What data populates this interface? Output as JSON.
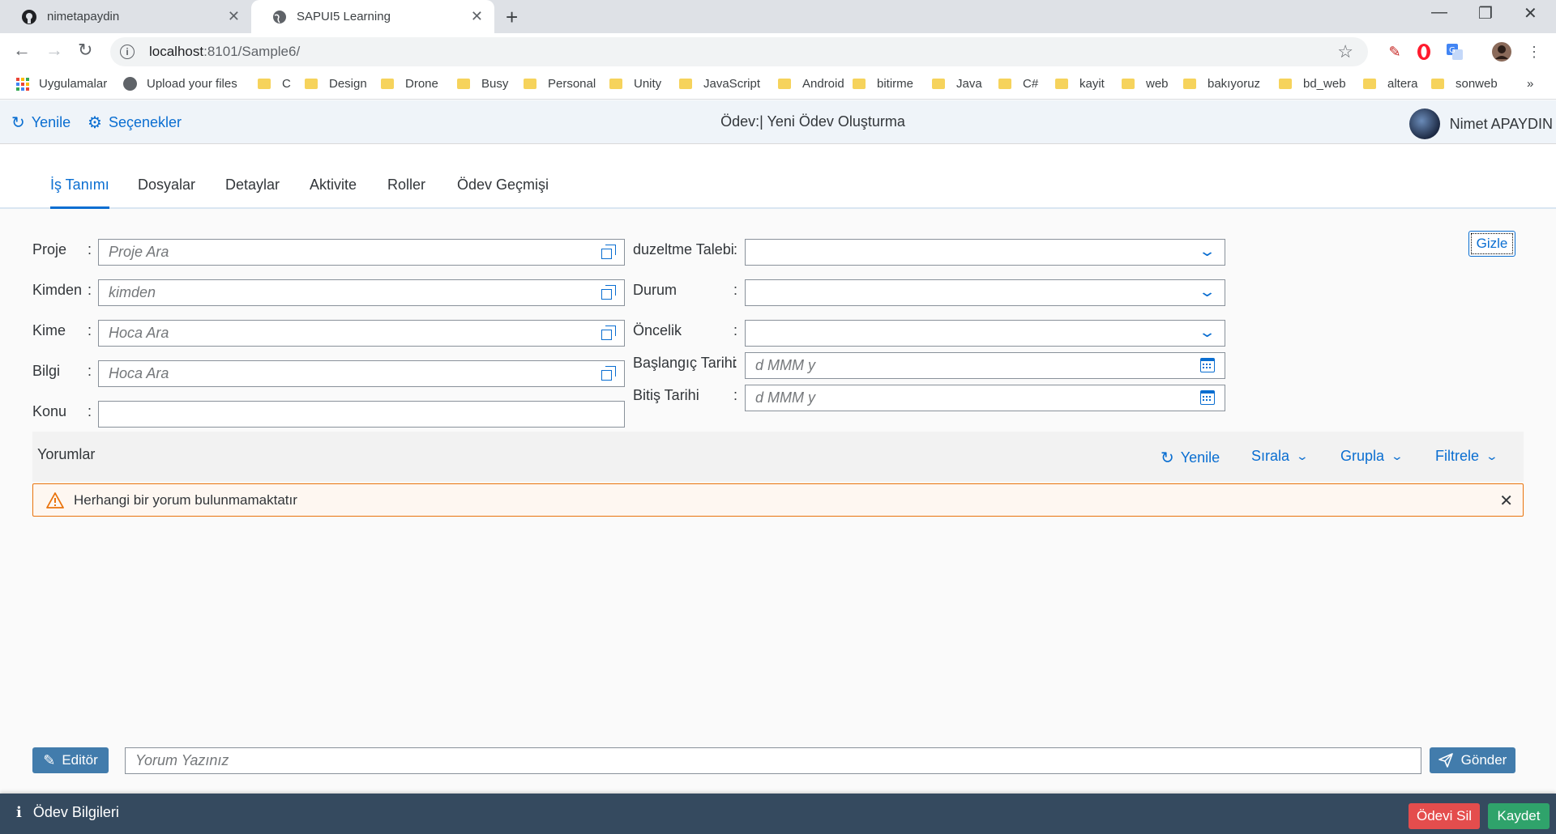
{
  "browser": {
    "tabs": [
      {
        "title": "nimetapaydin",
        "icon": "github-icon",
        "active": false
      },
      {
        "title": "SAPUI5 Learning",
        "icon": "globe-icon",
        "active": true
      }
    ],
    "new_tab": "+",
    "url_host": "localhost",
    "url_rest": ":8101/Sample6/",
    "window_controls": {
      "minimize": "—",
      "restore": "❐",
      "close": "✕"
    },
    "bookmarks": [
      {
        "label": "Uygulamalar",
        "icon": "apps-grid-icon"
      },
      {
        "label": "Upload your files",
        "icon": "globe-icon"
      },
      {
        "label": "C",
        "icon": "folder-icon"
      },
      {
        "label": "Design",
        "icon": "folder-icon"
      },
      {
        "label": "Drone",
        "icon": "folder-icon"
      },
      {
        "label": "Busy",
        "icon": "folder-icon"
      },
      {
        "label": "Personal",
        "icon": "folder-icon"
      },
      {
        "label": "Unity",
        "icon": "folder-icon"
      },
      {
        "label": "JavaScript",
        "icon": "folder-icon"
      },
      {
        "label": "Android",
        "icon": "folder-icon"
      },
      {
        "label": "bitirme",
        "icon": "folder-icon"
      },
      {
        "label": "Java",
        "icon": "folder-icon"
      },
      {
        "label": "C#",
        "icon": "folder-icon"
      },
      {
        "label": "kayit",
        "icon": "folder-icon"
      },
      {
        "label": "web",
        "icon": "folder-icon"
      },
      {
        "label": "bakıyoruz",
        "icon": "folder-icon"
      },
      {
        "label": "bd_web",
        "icon": "folder-icon"
      },
      {
        "label": "altera",
        "icon": "folder-icon"
      },
      {
        "label": "sonweb",
        "icon": "folder-icon"
      }
    ],
    "bookmarks_overflow": "»"
  },
  "shell": {
    "refresh_label": "Yenile",
    "options_label": "Seçenekler",
    "title": "Ödev:| Yeni Ödev Oluşturma",
    "user_name": "Nimet APAYDIN"
  },
  "tabs": [
    "İş Tanımı",
    "Dosyalar",
    "Detaylar",
    "Aktivite",
    "Roller",
    "Ödev Geçmişi"
  ],
  "form": {
    "left": [
      {
        "label": "Proje",
        "placeholder": "Proje Ara",
        "type": "valuehelp"
      },
      {
        "label": "Kimden",
        "placeholder": "kimden",
        "type": "valuehelp"
      },
      {
        "label": "Kime",
        "placeholder": "Hoca Ara",
        "type": "valuehelp"
      },
      {
        "label": "Bilgi",
        "placeholder": "Hoca Ara",
        "type": "valuehelp"
      },
      {
        "label": "Konu",
        "placeholder": "",
        "type": "text"
      }
    ],
    "right": [
      {
        "label": "duzeltme Talebi",
        "placeholder": "",
        "type": "select"
      },
      {
        "label": "Durum",
        "placeholder": "",
        "type": "select"
      },
      {
        "label": "Öncelik",
        "placeholder": "",
        "type": "select"
      },
      {
        "label": "Başlangıç Tarihi",
        "placeholder": "d MMM y",
        "type": "date"
      },
      {
        "label": "Bitiş Tarihi",
        "placeholder": "d MMM y",
        "type": "date"
      }
    ],
    "colon": ":",
    "hide_button": "Gizle"
  },
  "comments": {
    "title": "Yorumlar",
    "refresh": "Yenile",
    "sort": "Sırala",
    "group": "Grupla",
    "filter": "Filtrele",
    "warning": "Herhangi bir yorum bulunmamaktatır",
    "editor_button": "Editör",
    "input_placeholder": "Yorum Yazınız",
    "send_button": "Gönder"
  },
  "footer": {
    "info_label": "Ödev Bilgileri",
    "delete_button": "Ödevi Sil",
    "save_button": "Kaydet"
  },
  "colors": {
    "accent": "#0a6ed1",
    "emphasized_button": "#427cac",
    "footer": "#354a5f",
    "reject": "#e44d4d",
    "accept": "#2fa36b",
    "warning": "#e9730c"
  }
}
